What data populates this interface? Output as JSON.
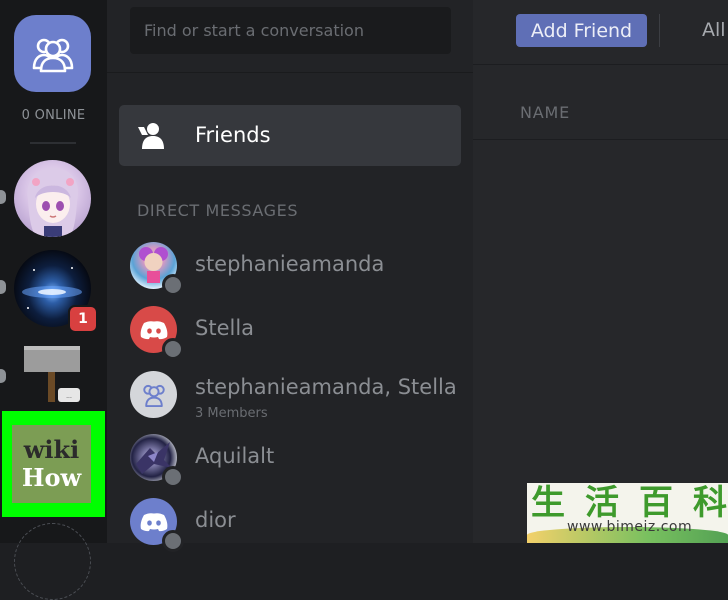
{
  "rail": {
    "online_count": "0 ONLINE",
    "servers": [
      {
        "name": "anime-girl-server"
      },
      {
        "name": "galaxy-server",
        "badge": "1"
      },
      {
        "name": "hammer-server"
      },
      {
        "name": "wikihow-server",
        "text_top": "wiki",
        "text_bottom": "How"
      }
    ]
  },
  "dm_panel": {
    "search_placeholder": "Find or start a conversation",
    "friends_label": "Friends",
    "section_header": "DIRECT MESSAGES",
    "items": [
      {
        "name": "stephanieamanda",
        "sub": ""
      },
      {
        "name": "Stella",
        "sub": ""
      },
      {
        "name": "stephanieamanda, Stella",
        "sub": "3 Members"
      },
      {
        "name": "Aquilalt",
        "sub": ""
      },
      {
        "name": "dior",
        "sub": ""
      }
    ]
  },
  "main": {
    "add_friend_label": "Add Friend",
    "tab_all_label": "All",
    "column_name_header": "NAME"
  },
  "watermark": {
    "chars": "生活百科",
    "url": "www.bimeiz.com"
  },
  "colors": {
    "blurple": "#6d7fcc",
    "highlight": "#00ff00",
    "badge_red": "#d84040",
    "status_offline": "#6b6f75"
  }
}
